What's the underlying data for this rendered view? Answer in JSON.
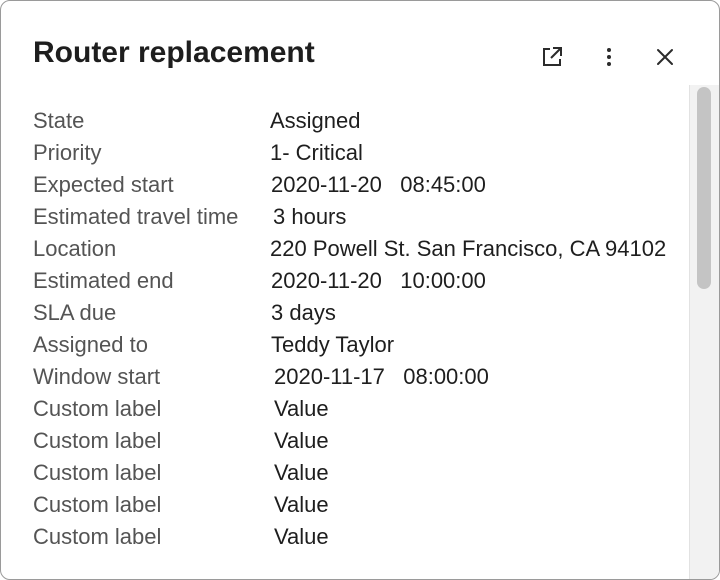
{
  "card": {
    "title": "Router replacement"
  },
  "header": {
    "actions": [
      {
        "icon": "open-in-new-icon"
      },
      {
        "icon": "more-vertical-icon"
      },
      {
        "icon": "close-icon"
      }
    ]
  },
  "fields": [
    {
      "label": "State",
      "value": "Assigned"
    },
    {
      "label": "Priority",
      "value": "1- Critical"
    },
    {
      "label": "Expected start",
      "value": "2020-11-20   08:45:00"
    },
    {
      "label": "Estimated travel time",
      "value": "3 hours"
    },
    {
      "label": "Location",
      "value": "220 Powell St. San Francisco, CA 94102"
    },
    {
      "label": "Estimated end",
      "value": "2020-11-20   10:00:00"
    },
    {
      "label": "SLA due",
      "value": "3 days"
    },
    {
      "label": "Assigned to",
      "value": "Teddy Taylor"
    },
    {
      "label": "Window start",
      "value": "2020-11-17   08:00:00"
    },
    {
      "label": "Custom label",
      "value": "Value"
    },
    {
      "label": "Custom label",
      "value": "Value"
    },
    {
      "label": "Custom label",
      "value": "Value"
    },
    {
      "label": "Custom label",
      "value": "Value"
    },
    {
      "label": "Custom label",
      "value": "Value"
    }
  ],
  "colors": {
    "title": "#1e1e1e",
    "label": "#545454",
    "value": "#1e1e1e",
    "icon": "#2b2b2b",
    "border": "#9a9a9a",
    "scroll_track": "#f2f2f2",
    "scroll_thumb": "#c4c4c4"
  },
  "scroll": {
    "position": 0
  }
}
